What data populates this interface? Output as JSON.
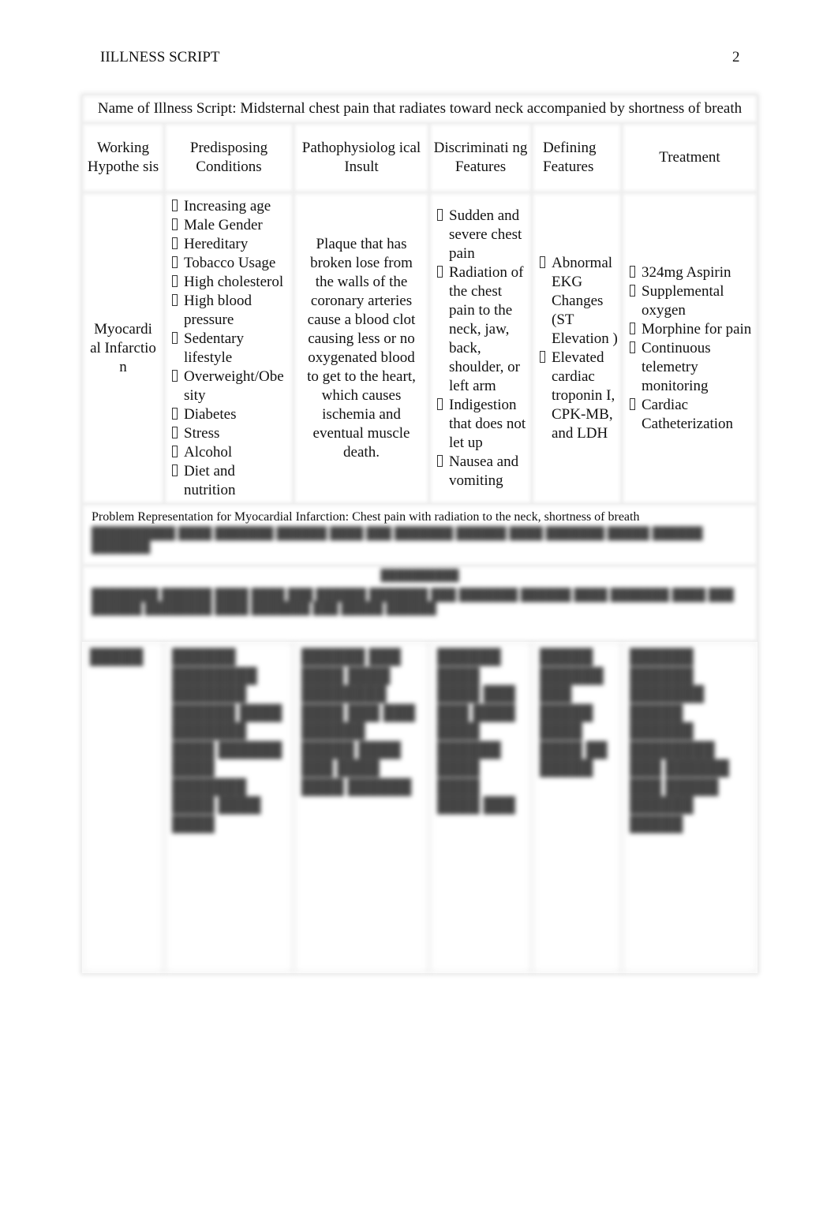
{
  "header": {
    "running_head": "IILLNESS SCRIPT",
    "page_number": "2"
  },
  "table": {
    "title": "Name of Illness Script: Midsternal chest pain that radiates toward neck accompanied by shortness of breath",
    "columns": [
      "Working Hypothe sis",
      "Predisposing Conditions",
      "Pathophysiolog ical Insult",
      "Discriminati ng Features",
      "Defining Features",
      "Treatment"
    ],
    "row": {
      "working_hypothesis": "Myocardi al Infarctio n",
      "predisposing": [
        "Increasing age",
        "Male Gender",
        "Hereditary",
        "Tobacco Usage",
        "High cholesterol",
        "High blood pressure",
        "Sedentary lifestyle",
        "Overweight/Obe sity",
        "Diabetes",
        "Stress",
        "Alcohol",
        "Diet and nutrition"
      ],
      "pathophysiology": "Plaque that has broken lose from the walls of the coronary arteries cause a blood clot causing less or no oxygenated blood to get to the heart, which causes ischemia and eventual muscle death.",
      "discriminating": [
        "Sudden and severe chest pain",
        "Radiation of the chest pain to the neck, jaw, back, shoulder, or left arm",
        "Indigestion that does not let up",
        "Nausea and vomiting"
      ],
      "defining": [
        "Abnormal EKG Changes (ST Elevation )",
        "Elevated cardiac troponin I, CPK-MB, and LDH"
      ],
      "treatment": [
        "324mg Aspirin",
        "Supplemental oxygen",
        "Morphine for pain",
        "Continuous telemetry monitoring",
        "Cardiac Catheterization"
      ]
    },
    "problem_representation": "Problem Representation for Myocardial Infarction: Chest pain with radiation to the neck, shortness of breath",
    "obscured_note": "[blurred content]"
  }
}
